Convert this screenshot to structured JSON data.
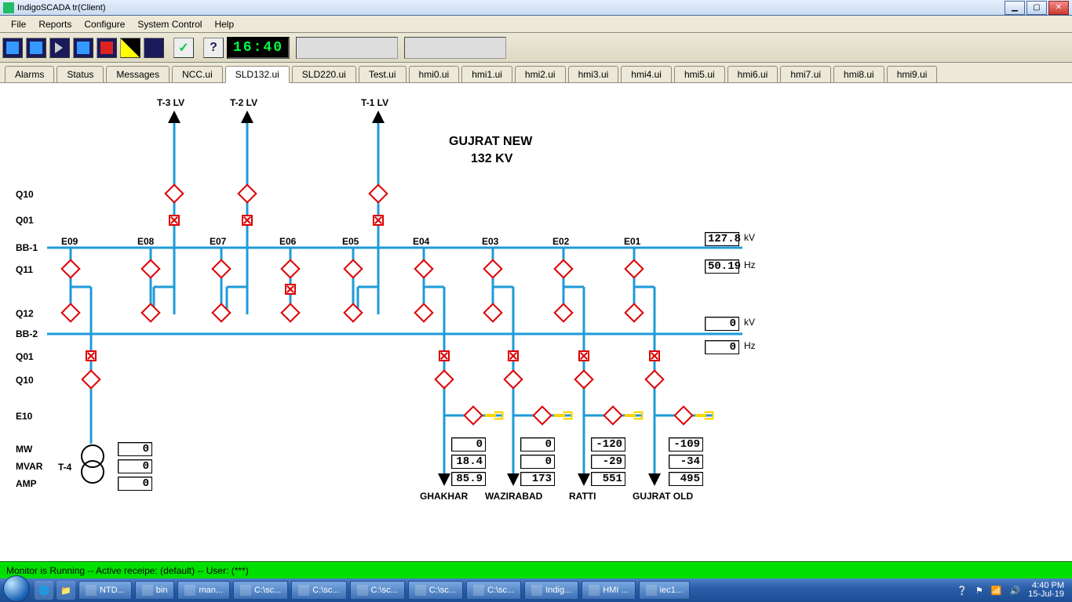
{
  "window": {
    "title": "IndigoSCADA tr(Client)"
  },
  "menu": [
    "File",
    "Reports",
    "Configure",
    "System Control",
    "Help"
  ],
  "toolbar": {
    "clock": "16:40"
  },
  "tabs": [
    "Alarms",
    "Status",
    "Messages",
    "NCC.ui",
    "SLD132.ui",
    "SLD220.ui",
    "Test.ui",
    "hmi0.ui",
    "hmi1.ui",
    "hmi2.ui",
    "hmi3.ui",
    "hmi4.ui",
    "hmi5.ui",
    "hmi6.ui",
    "hmi7.ui",
    "hmi8.ui",
    "hmi9.ui"
  ],
  "active_tab": "SLD132.ui",
  "diagram": {
    "title_line1": "GUJRAT NEW",
    "title_line2": "132 KV",
    "row_labels": {
      "Q10": "Q10",
      "Q01": "Q01",
      "BB1": "BB-1",
      "Q11": "Q11",
      "Q12": "Q12",
      "BB2": "BB-2",
      "Q01b": "Q01",
      "Q10b": "Q10",
      "E10": "E10",
      "MW": "MW",
      "MVAR": "MVAR",
      "AMP": "AMP"
    },
    "bay_labels": {
      "E09": "E09",
      "E08": "E08",
      "E07": "E07",
      "E06": "E06",
      "E05": "E05",
      "E04": "E04",
      "E03": "E03",
      "E02": "E02",
      "E01": "E01"
    },
    "top_labels": {
      "T3": "T-3 LV",
      "T2": "T-2 LV",
      "T1": "T-1 LV"
    },
    "feeders": {
      "GHAKHAR": "GHAKHAR",
      "WAZIRABAD": "WAZIRABAD",
      "RATTI": "RATTI",
      "GUJRAT_OLD": "GUJRAT OLD"
    },
    "trafo_label": "T-4",
    "bus1": {
      "kv": "127.8",
      "kv_u": "kV",
      "hz": "50.19",
      "hz_u": "Hz"
    },
    "bus2": {
      "kv": "0",
      "kv_u": "kV",
      "hz": "0",
      "hz_u": "Hz"
    },
    "t4": {
      "mw": "0",
      "mvar": "0",
      "amp": "0"
    },
    "feeder_vals": {
      "GHAKHAR": {
        "mw": "0",
        "mvar": "18.4",
        "amp": "85.9"
      },
      "WAZIRABAD": {
        "mw": "0",
        "mvar": "0",
        "amp": "173"
      },
      "RATTI": {
        "mw": "-120",
        "mvar": "-29",
        "amp": "551"
      },
      "GUJRAT_OLD": {
        "mw": "-109",
        "mvar": "-34",
        "amp": "495"
      }
    }
  },
  "status": "Monitor is Running -- Active receipe: (default) -- User: (***)",
  "taskbar": {
    "items": [
      {
        "l": "NTD..."
      },
      {
        "l": "bin"
      },
      {
        "l": "man..."
      },
      {
        "l": "C:\\sc..."
      },
      {
        "l": "C:\\sc..."
      },
      {
        "l": "C:\\sc..."
      },
      {
        "l": "C:\\sc..."
      },
      {
        "l": "C:\\sc..."
      },
      {
        "l": "Indig..."
      },
      {
        "l": "HMI ..."
      },
      {
        "l": "iec1..."
      }
    ],
    "time": "4:40 PM",
    "date": "15-Jul-19"
  }
}
